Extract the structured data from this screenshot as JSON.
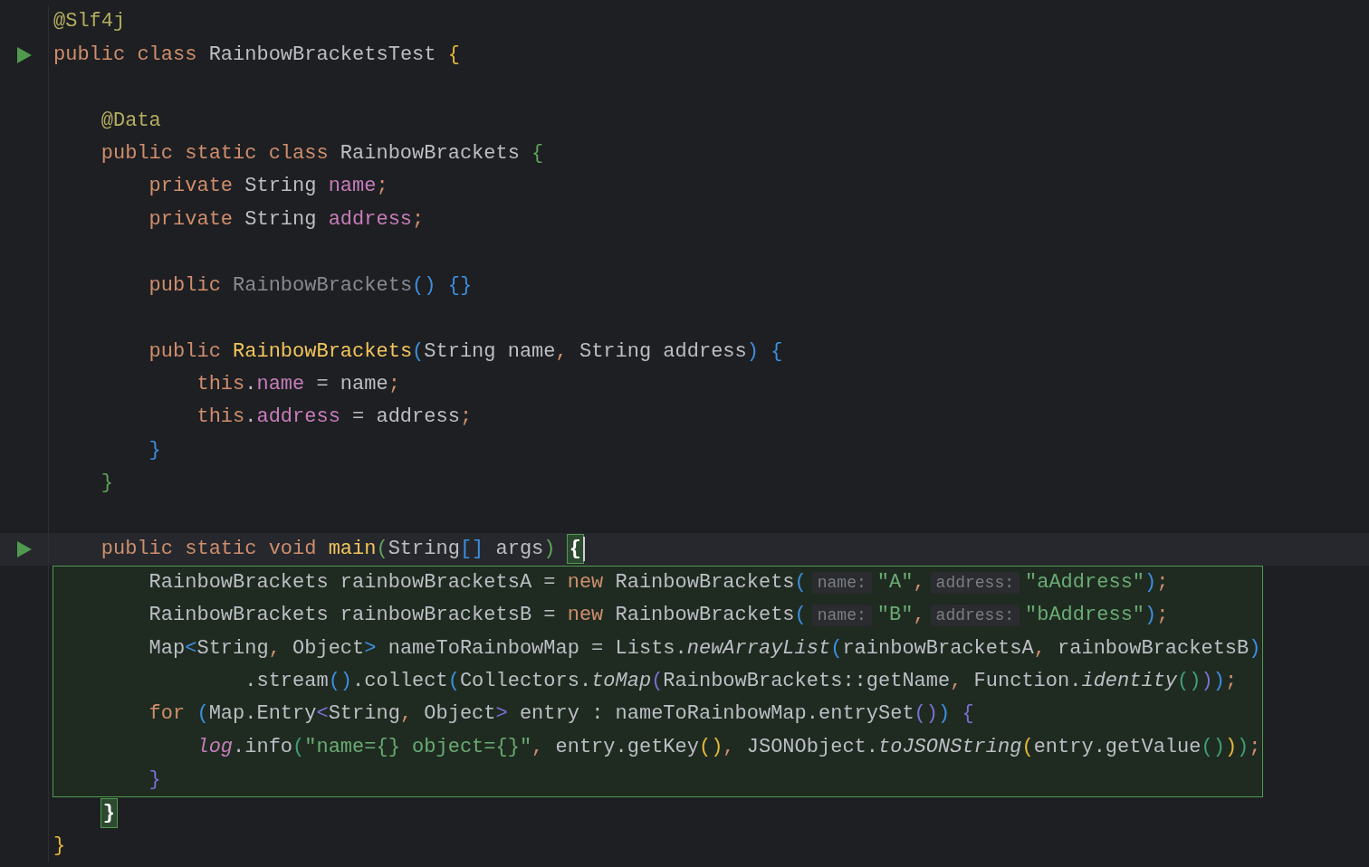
{
  "editor": {
    "lines": [
      {
        "kind": "code",
        "tokens": [
          {
            "text": "@Slf4j",
            "kind": "annotation"
          }
        ]
      },
      {
        "kind": "code",
        "run": true,
        "tokens": [
          {
            "text": "public class ",
            "kind": "keyword"
          },
          {
            "text": "RainbowBracketsTest ",
            "kind": "plain"
          },
          {
            "text": "{",
            "kind": "bracket",
            "color": "#e8b93a"
          }
        ]
      },
      {
        "kind": "blank"
      },
      {
        "kind": "code",
        "tokens": [
          {
            "text": "    @Data",
            "kind": "annotation"
          }
        ]
      },
      {
        "kind": "code",
        "tokens": [
          {
            "text": "    public static class ",
            "kind": "keyword"
          },
          {
            "text": "RainbowBrackets ",
            "kind": "plain"
          },
          {
            "text": "{",
            "kind": "bracket",
            "color": "#5fa55a"
          }
        ]
      },
      {
        "kind": "code",
        "tokens": [
          {
            "text": "        private ",
            "kind": "keyword"
          },
          {
            "text": "String ",
            "kind": "plain"
          },
          {
            "text": "name",
            "kind": "field"
          },
          {
            "text": ";",
            "kind": "punct"
          }
        ]
      },
      {
        "kind": "code",
        "tokens": [
          {
            "text": "        private ",
            "kind": "keyword"
          },
          {
            "text": "String ",
            "kind": "plain"
          },
          {
            "text": "address",
            "kind": "field"
          },
          {
            "text": ";",
            "kind": "punct"
          }
        ]
      },
      {
        "kind": "blank"
      },
      {
        "kind": "code",
        "tokens": [
          {
            "text": "        public ",
            "kind": "keyword"
          },
          {
            "text": "RainbowBrackets",
            "kind": "unused"
          },
          {
            "text": "()",
            "kind": "bracket",
            "color": "#3d8fe0"
          },
          {
            "text": " {}",
            "kind": "bracket",
            "color": "#3d8fe0"
          }
        ]
      },
      {
        "kind": "blank"
      },
      {
        "kind": "code",
        "tokens": [
          {
            "text": "        public ",
            "kind": "keyword"
          },
          {
            "text": "RainbowBrackets",
            "kind": "declaration"
          },
          {
            "text": "(",
            "kind": "bracket",
            "color": "#3d8fe0"
          },
          {
            "text": "String name",
            "kind": "plain"
          },
          {
            "text": ", ",
            "kind": "punct"
          },
          {
            "text": "String address",
            "kind": "plain"
          },
          {
            "text": ")",
            "kind": "bracket",
            "color": "#3d8fe0"
          },
          {
            "text": " {",
            "kind": "bracket",
            "color": "#3d8fe0"
          }
        ]
      },
      {
        "kind": "code",
        "tokens": [
          {
            "text": "            this",
            "kind": "keyword"
          },
          {
            "text": ".",
            "kind": "plain"
          },
          {
            "text": "name",
            "kind": "field"
          },
          {
            "text": " = name",
            "kind": "plain"
          },
          {
            "text": ";",
            "kind": "punct"
          }
        ]
      },
      {
        "kind": "code",
        "tokens": [
          {
            "text": "            this",
            "kind": "keyword"
          },
          {
            "text": ".",
            "kind": "plain"
          },
          {
            "text": "address",
            "kind": "field"
          },
          {
            "text": " = address",
            "kind": "plain"
          },
          {
            "text": ";",
            "kind": "punct"
          }
        ]
      },
      {
        "kind": "code",
        "tokens": [
          {
            "text": "        }",
            "kind": "bracket",
            "color": "#3d8fe0"
          }
        ]
      },
      {
        "kind": "code",
        "tokens": [
          {
            "text": "    }",
            "kind": "bracket",
            "color": "#5fa55a"
          }
        ]
      },
      {
        "kind": "blank"
      },
      {
        "kind": "scope_start",
        "run": true,
        "current": true,
        "tokens": [
          {
            "text": "    public static void ",
            "kind": "keyword"
          },
          {
            "text": "main",
            "kind": "declaration"
          },
          {
            "text": "(",
            "kind": "bracket",
            "color": "#5fa55a"
          },
          {
            "text": "String",
            "kind": "plain"
          },
          {
            "text": "[]",
            "kind": "bracket",
            "color": "#3d8fe0"
          },
          {
            "text": " args",
            "kind": "plain"
          },
          {
            "text": ") ",
            "kind": "bracket",
            "color": "#5fa55a"
          },
          {
            "text": "{",
            "kind": "match",
            "cursor": true
          }
        ]
      },
      {
        "kind": "scope_body",
        "tokens": [
          {
            "text": "        RainbowBrackets rainbowBracketsA = ",
            "kind": "plain"
          },
          {
            "text": "new ",
            "kind": "keyword"
          },
          {
            "text": "RainbowBrackets",
            "kind": "plain"
          },
          {
            "text": "(",
            "kind": "bracket",
            "color": "#3d8fe0"
          },
          {
            "text": "name:",
            "kind": "hint"
          },
          {
            "text": "\"A\"",
            "kind": "string"
          },
          {
            "text": ",",
            "kind": "punct"
          },
          {
            "text": "address:",
            "kind": "hint"
          },
          {
            "text": "\"aAddress\"",
            "kind": "string"
          },
          {
            "text": ")",
            "kind": "bracket",
            "color": "#3d8fe0"
          },
          {
            "text": ";",
            "kind": "punct"
          }
        ]
      },
      {
        "kind": "scope_body",
        "tokens": [
          {
            "text": "        RainbowBrackets rainbowBracketsB = ",
            "kind": "plain"
          },
          {
            "text": "new ",
            "kind": "keyword"
          },
          {
            "text": "RainbowBrackets",
            "kind": "plain"
          },
          {
            "text": "(",
            "kind": "bracket",
            "color": "#3d8fe0"
          },
          {
            "text": "name:",
            "kind": "hint"
          },
          {
            "text": "\"B\"",
            "kind": "string"
          },
          {
            "text": ",",
            "kind": "punct"
          },
          {
            "text": "address:",
            "kind": "hint"
          },
          {
            "text": "\"bAddress\"",
            "kind": "string"
          },
          {
            "text": ")",
            "kind": "bracket",
            "color": "#3d8fe0"
          },
          {
            "text": ";",
            "kind": "punct"
          }
        ]
      },
      {
        "kind": "scope_body",
        "tokens": [
          {
            "text": "        Map",
            "kind": "plain"
          },
          {
            "text": "<",
            "kind": "bracket",
            "color": "#3d8fe0"
          },
          {
            "text": "String",
            "kind": "plain"
          },
          {
            "text": ", ",
            "kind": "punct"
          },
          {
            "text": "Object",
            "kind": "plain"
          },
          {
            "text": ">",
            "kind": "bracket",
            "color": "#3d8fe0"
          },
          {
            "text": " nameToRainbowMap = Lists.",
            "kind": "plain"
          },
          {
            "text": "newArrayList",
            "kind": "static"
          },
          {
            "text": "(",
            "kind": "bracket",
            "color": "#3d8fe0"
          },
          {
            "text": "rainbowBracketsA",
            "kind": "plain"
          },
          {
            "text": ", ",
            "kind": "punct"
          },
          {
            "text": "rainbowBracketsB",
            "kind": "plain"
          },
          {
            "text": ")",
            "kind": "bracket",
            "color": "#3d8fe0"
          }
        ]
      },
      {
        "kind": "scope_body",
        "tokens": [
          {
            "text": "                .stream",
            "kind": "plain"
          },
          {
            "text": "()",
            "kind": "bracket",
            "color": "#3d8fe0"
          },
          {
            "text": ".collect",
            "kind": "plain"
          },
          {
            "text": "(",
            "kind": "bracket",
            "color": "#3d8fe0"
          },
          {
            "text": "Collectors.",
            "kind": "plain"
          },
          {
            "text": "toMap",
            "kind": "static"
          },
          {
            "text": "(",
            "kind": "bracket",
            "color": "#7f6fd6"
          },
          {
            "text": "RainbowBrackets::getName",
            "kind": "plain"
          },
          {
            "text": ", ",
            "kind": "punct"
          },
          {
            "text": "Function.",
            "kind": "plain"
          },
          {
            "text": "identity",
            "kind": "static"
          },
          {
            "text": "()",
            "kind": "bracket",
            "color": "#3fa07a"
          },
          {
            "text": ")",
            "kind": "bracket",
            "color": "#7f6fd6"
          },
          {
            "text": ")",
            "kind": "bracket",
            "color": "#3d8fe0"
          },
          {
            "text": ";",
            "kind": "punct"
          }
        ]
      },
      {
        "kind": "scope_body",
        "tokens": [
          {
            "text": "        for ",
            "kind": "keyword"
          },
          {
            "text": "(",
            "kind": "bracket",
            "color": "#3d8fe0"
          },
          {
            "text": "Map.Entry",
            "kind": "plain"
          },
          {
            "text": "<",
            "kind": "bracket",
            "color": "#7f6fd6"
          },
          {
            "text": "String",
            "kind": "plain"
          },
          {
            "text": ", ",
            "kind": "punct"
          },
          {
            "text": "Object",
            "kind": "plain"
          },
          {
            "text": ">",
            "kind": "bracket",
            "color": "#7f6fd6"
          },
          {
            "text": " entry : nameToRainbowMap.entrySet",
            "kind": "plain"
          },
          {
            "text": "()",
            "kind": "bracket",
            "color": "#7f6fd6"
          },
          {
            "text": ")",
            "kind": "bracket",
            "color": "#3d8fe0"
          },
          {
            "text": " {",
            "kind": "bracket",
            "color": "#7f6fd6"
          }
        ]
      },
      {
        "kind": "scope_body",
        "tokens": [
          {
            "text": "            log",
            "kind": "static-field"
          },
          {
            "text": ".info",
            "kind": "plain"
          },
          {
            "text": "(",
            "kind": "bracket",
            "color": "#3fa07a"
          },
          {
            "text": "\"name={} object={}\"",
            "kind": "string"
          },
          {
            "text": ", ",
            "kind": "punct"
          },
          {
            "text": "entry.getKey",
            "kind": "plain"
          },
          {
            "text": "()",
            "kind": "bracket",
            "color": "#e8b93a"
          },
          {
            "text": ", ",
            "kind": "punct"
          },
          {
            "text": "JSONObject.",
            "kind": "plain"
          },
          {
            "text": "toJSONString",
            "kind": "static"
          },
          {
            "text": "(",
            "kind": "bracket",
            "color": "#e8b93a"
          },
          {
            "text": "entry.getValue",
            "kind": "plain"
          },
          {
            "text": "()",
            "kind": "bracket",
            "color": "#3fa07a"
          },
          {
            "text": ")",
            "kind": "bracket",
            "color": "#e8b93a"
          },
          {
            "text": ")",
            "kind": "bracket",
            "color": "#3fa07a"
          },
          {
            "text": ";",
            "kind": "punct"
          }
        ]
      },
      {
        "kind": "scope_body",
        "tokens": [
          {
            "text": "        }",
            "kind": "bracket",
            "color": "#7f6fd6"
          }
        ]
      },
      {
        "kind": "scope_end",
        "tokens": [
          {
            "text": "}",
            "kind": "match",
            "cursor": false
          }
        ]
      },
      {
        "kind": "code",
        "tokens": [
          {
            "text": "}",
            "kind": "bracket",
            "color": "#e8b93a"
          }
        ]
      }
    ]
  }
}
